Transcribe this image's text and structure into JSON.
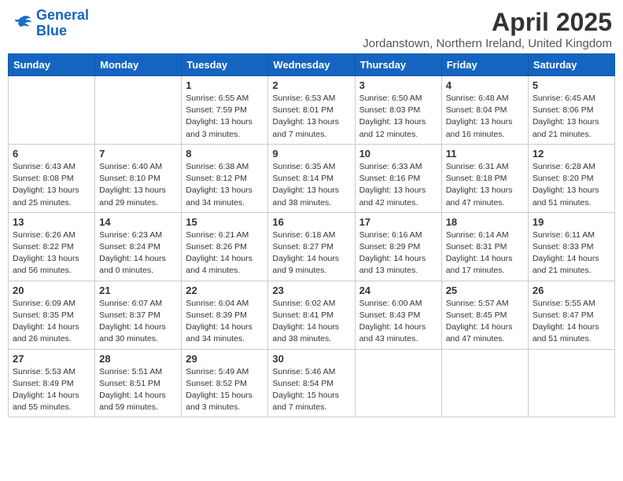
{
  "header": {
    "logo_line1": "General",
    "logo_line2": "Blue",
    "main_title": "April 2025",
    "subtitle": "Jordanstown, Northern Ireland, United Kingdom"
  },
  "weekdays": [
    "Sunday",
    "Monday",
    "Tuesday",
    "Wednesday",
    "Thursday",
    "Friday",
    "Saturday"
  ],
  "weeks": [
    [
      {
        "day": "",
        "info": ""
      },
      {
        "day": "",
        "info": ""
      },
      {
        "day": "1",
        "info": "Sunrise: 6:55 AM\nSunset: 7:59 PM\nDaylight: 13 hours\nand 3 minutes."
      },
      {
        "day": "2",
        "info": "Sunrise: 6:53 AM\nSunset: 8:01 PM\nDaylight: 13 hours\nand 7 minutes."
      },
      {
        "day": "3",
        "info": "Sunrise: 6:50 AM\nSunset: 8:03 PM\nDaylight: 13 hours\nand 12 minutes."
      },
      {
        "day": "4",
        "info": "Sunrise: 6:48 AM\nSunset: 8:04 PM\nDaylight: 13 hours\nand 16 minutes."
      },
      {
        "day": "5",
        "info": "Sunrise: 6:45 AM\nSunset: 8:06 PM\nDaylight: 13 hours\nand 21 minutes."
      }
    ],
    [
      {
        "day": "6",
        "info": "Sunrise: 6:43 AM\nSunset: 8:08 PM\nDaylight: 13 hours\nand 25 minutes."
      },
      {
        "day": "7",
        "info": "Sunrise: 6:40 AM\nSunset: 8:10 PM\nDaylight: 13 hours\nand 29 minutes."
      },
      {
        "day": "8",
        "info": "Sunrise: 6:38 AM\nSunset: 8:12 PM\nDaylight: 13 hours\nand 34 minutes."
      },
      {
        "day": "9",
        "info": "Sunrise: 6:35 AM\nSunset: 8:14 PM\nDaylight: 13 hours\nand 38 minutes."
      },
      {
        "day": "10",
        "info": "Sunrise: 6:33 AM\nSunset: 8:16 PM\nDaylight: 13 hours\nand 42 minutes."
      },
      {
        "day": "11",
        "info": "Sunrise: 6:31 AM\nSunset: 8:18 PM\nDaylight: 13 hours\nand 47 minutes."
      },
      {
        "day": "12",
        "info": "Sunrise: 6:28 AM\nSunset: 8:20 PM\nDaylight: 13 hours\nand 51 minutes."
      }
    ],
    [
      {
        "day": "13",
        "info": "Sunrise: 6:26 AM\nSunset: 8:22 PM\nDaylight: 13 hours\nand 56 minutes."
      },
      {
        "day": "14",
        "info": "Sunrise: 6:23 AM\nSunset: 8:24 PM\nDaylight: 14 hours\nand 0 minutes."
      },
      {
        "day": "15",
        "info": "Sunrise: 6:21 AM\nSunset: 8:26 PM\nDaylight: 14 hours\nand 4 minutes."
      },
      {
        "day": "16",
        "info": "Sunrise: 6:18 AM\nSunset: 8:27 PM\nDaylight: 14 hours\nand 9 minutes."
      },
      {
        "day": "17",
        "info": "Sunrise: 6:16 AM\nSunset: 8:29 PM\nDaylight: 14 hours\nand 13 minutes."
      },
      {
        "day": "18",
        "info": "Sunrise: 6:14 AM\nSunset: 8:31 PM\nDaylight: 14 hours\nand 17 minutes."
      },
      {
        "day": "19",
        "info": "Sunrise: 6:11 AM\nSunset: 8:33 PM\nDaylight: 14 hours\nand 21 minutes."
      }
    ],
    [
      {
        "day": "20",
        "info": "Sunrise: 6:09 AM\nSunset: 8:35 PM\nDaylight: 14 hours\nand 26 minutes."
      },
      {
        "day": "21",
        "info": "Sunrise: 6:07 AM\nSunset: 8:37 PM\nDaylight: 14 hours\nand 30 minutes."
      },
      {
        "day": "22",
        "info": "Sunrise: 6:04 AM\nSunset: 8:39 PM\nDaylight: 14 hours\nand 34 minutes."
      },
      {
        "day": "23",
        "info": "Sunrise: 6:02 AM\nSunset: 8:41 PM\nDaylight: 14 hours\nand 38 minutes."
      },
      {
        "day": "24",
        "info": "Sunrise: 6:00 AM\nSunset: 8:43 PM\nDaylight: 14 hours\nand 43 minutes."
      },
      {
        "day": "25",
        "info": "Sunrise: 5:57 AM\nSunset: 8:45 PM\nDaylight: 14 hours\nand 47 minutes."
      },
      {
        "day": "26",
        "info": "Sunrise: 5:55 AM\nSunset: 8:47 PM\nDaylight: 14 hours\nand 51 minutes."
      }
    ],
    [
      {
        "day": "27",
        "info": "Sunrise: 5:53 AM\nSunset: 8:49 PM\nDaylight: 14 hours\nand 55 minutes."
      },
      {
        "day": "28",
        "info": "Sunrise: 5:51 AM\nSunset: 8:51 PM\nDaylight: 14 hours\nand 59 minutes."
      },
      {
        "day": "29",
        "info": "Sunrise: 5:49 AM\nSunset: 8:52 PM\nDaylight: 15 hours\nand 3 minutes."
      },
      {
        "day": "30",
        "info": "Sunrise: 5:46 AM\nSunset: 8:54 PM\nDaylight: 15 hours\nand 7 minutes."
      },
      {
        "day": "",
        "info": ""
      },
      {
        "day": "",
        "info": ""
      },
      {
        "day": "",
        "info": ""
      }
    ]
  ]
}
